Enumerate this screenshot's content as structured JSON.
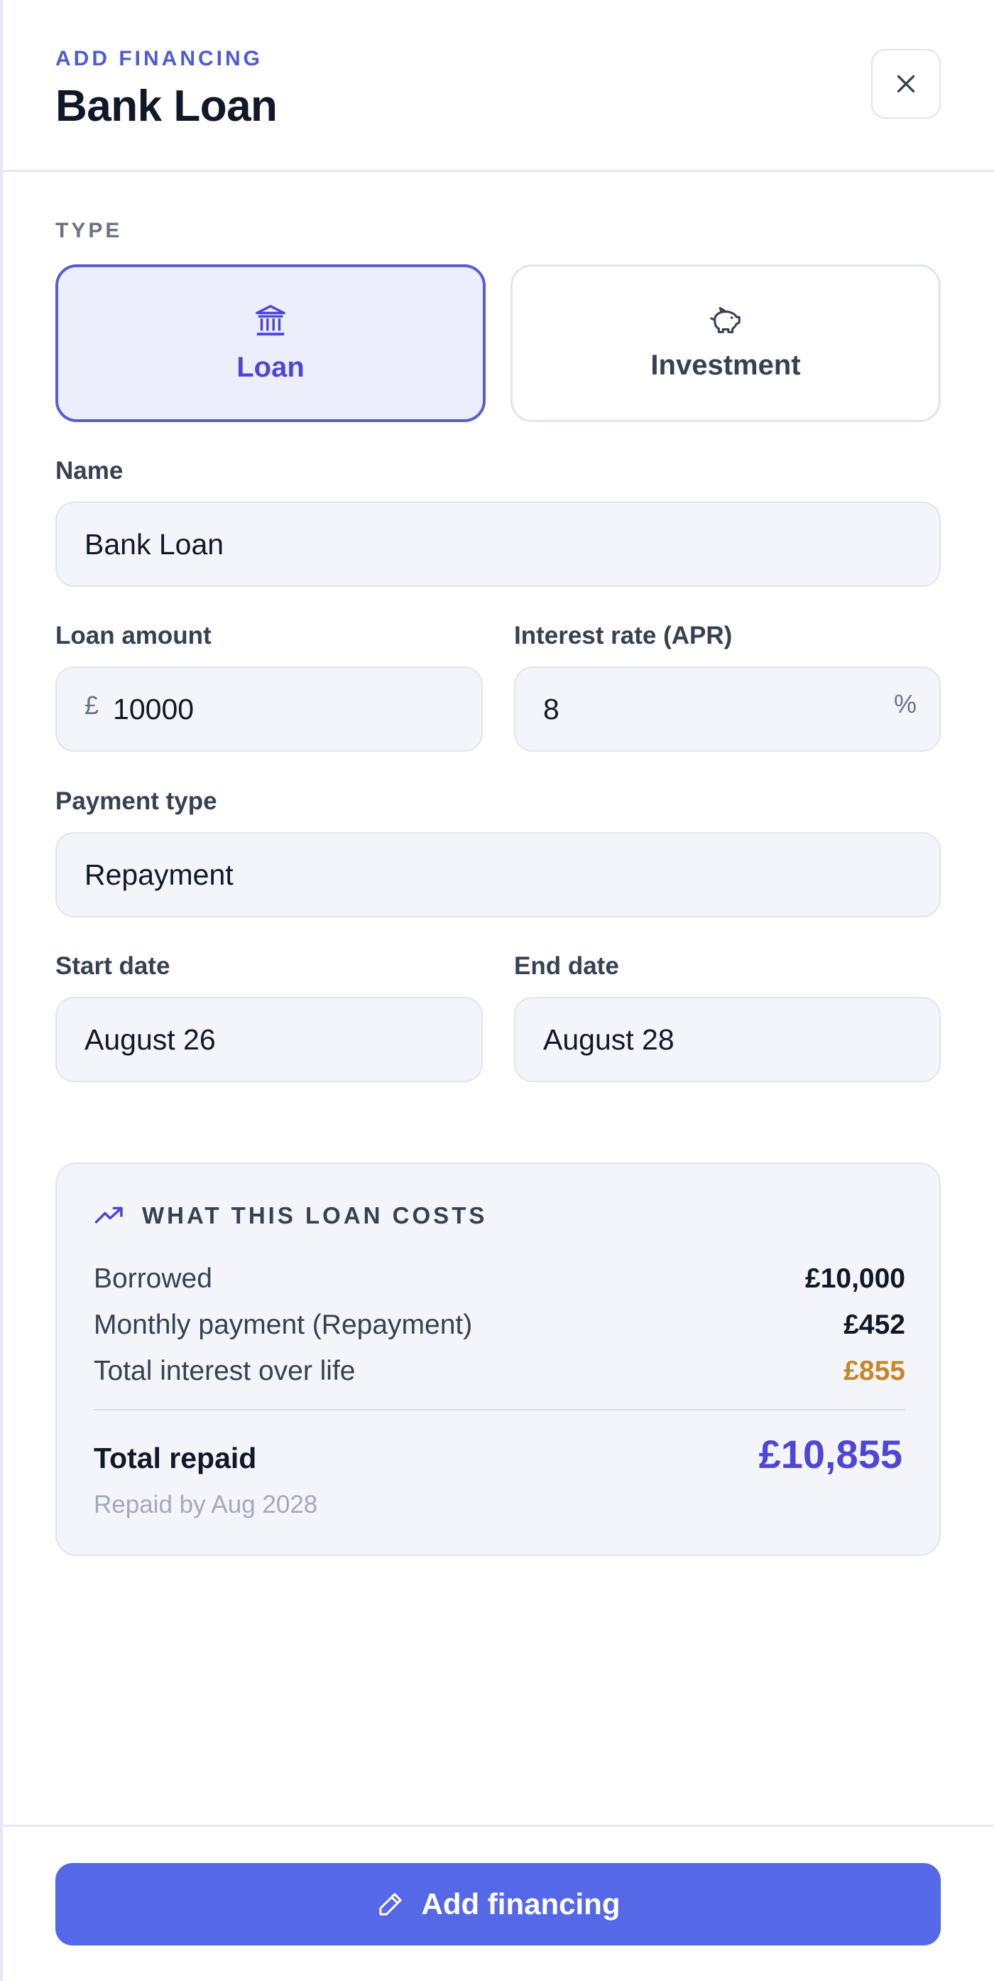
{
  "header": {
    "eyebrow": "ADD FINANCING",
    "title": "Bank Loan",
    "close_icon": "close-icon"
  },
  "type_section": {
    "label": "TYPE",
    "options": [
      {
        "label": "Loan",
        "icon": "bank-icon",
        "selected": true
      },
      {
        "label": "Investment",
        "icon": "piggy-bank-icon",
        "selected": false
      }
    ]
  },
  "form": {
    "name": {
      "label": "Name",
      "value": "Bank Loan"
    },
    "loan_amount": {
      "label": "Loan amount",
      "prefix": "£",
      "value": "10000"
    },
    "interest_rate": {
      "label": "Interest rate (APR)",
      "value": "8",
      "suffix": "%"
    },
    "payment_type": {
      "label": "Payment type",
      "value": "Repayment"
    },
    "start_date": {
      "label": "Start date",
      "value": "August 26"
    },
    "end_date": {
      "label": "End date",
      "value": "August 28"
    }
  },
  "summary": {
    "icon": "trending-up-icon",
    "title": "WHAT THIS LOAN COSTS",
    "rows": [
      {
        "label": "Borrowed",
        "value": "£10,000"
      },
      {
        "label": "Monthly payment (Repayment)",
        "value": "£452"
      },
      {
        "label": "Total interest over life",
        "value": "£855"
      }
    ],
    "total_label": "Total repaid",
    "total_value": "£10,855",
    "total_note": "Repaid by Aug 2028"
  },
  "footer": {
    "button_label": "Add financing",
    "button_icon": "pencil-icon"
  },
  "colors": {
    "accent": "#5b5bd6",
    "button": "#5468e8",
    "interest": "#c8862a"
  }
}
